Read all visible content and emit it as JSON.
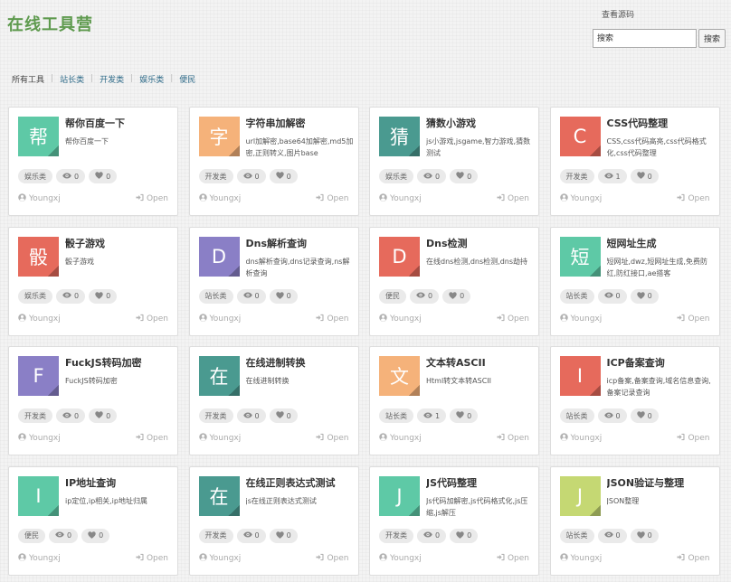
{
  "header": {
    "logo": "在线工具营",
    "source_link": "查看源码",
    "search_placeholder": "搜索",
    "search_button": "搜索"
  },
  "breadcrumb": [
    {
      "label": "所有工具",
      "link": false
    },
    {
      "label": "站长类",
      "link": true
    },
    {
      "label": "开发类",
      "link": true
    },
    {
      "label": "娱乐类",
      "link": true
    },
    {
      "label": "便民",
      "link": true
    }
  ],
  "colors": {
    "logo": "#5e9a4e",
    "teal": "#5ec9a6",
    "orange": "#f5b27a",
    "darkteal": "#4a9a90",
    "red": "#e66a5c",
    "purple": "#8a7fc6",
    "lime": "#c5d873"
  },
  "open_label": "Open",
  "tools": [
    {
      "char": "帮",
      "color": "teal",
      "title": "帮你百度一下",
      "desc": "帮你百度一下",
      "category": "娱乐类",
      "views": "0",
      "likes": "0",
      "author": "Youngxj"
    },
    {
      "char": "字",
      "color": "orange",
      "title": "字符串加解密",
      "desc": "url加解密,base64加解密,md5加密,正则转义,图片base",
      "category": "开发类",
      "views": "0",
      "likes": "0",
      "author": "Youngxj"
    },
    {
      "char": "猜",
      "color": "darkteal",
      "title": "猜数小游戏",
      "desc": "js小游戏,jsgame,智力游戏,猜数测试",
      "category": "娱乐类",
      "views": "0",
      "likes": "0",
      "author": "Youngxj"
    },
    {
      "char": "C",
      "color": "red",
      "title": "CSS代码整理",
      "desc": "CSS,css代码高亮,css代码格式化,css代码整理",
      "category": "开发类",
      "views": "1",
      "likes": "0",
      "author": "Youngxj"
    },
    {
      "char": "骰",
      "color": "red",
      "title": "骰子游戏",
      "desc": "骰子游戏",
      "category": "娱乐类",
      "views": "0",
      "likes": "0",
      "author": "Youngxj"
    },
    {
      "char": "D",
      "color": "purple",
      "title": "Dns解析查询",
      "desc": "dns解析查询,dns记录查询,ns解析查询",
      "category": "站长类",
      "views": "0",
      "likes": "0",
      "author": "Youngxj"
    },
    {
      "char": "D",
      "color": "red",
      "title": "Dns检测",
      "desc": "在线dns检测,dns检测,dns劫持",
      "category": "便民",
      "views": "0",
      "likes": "0",
      "author": "Youngxj"
    },
    {
      "char": "短",
      "color": "teal",
      "title": "短网址生成",
      "desc": "短网址,dwz,短网址生成,免费防红,防红接口,ae搭客",
      "category": "站长类",
      "views": "0",
      "likes": "0",
      "author": "Youngxj"
    },
    {
      "char": "F",
      "color": "purple",
      "title": "FuckJS转码加密",
      "desc": "FuckJS转码加密",
      "category": "开发类",
      "views": "0",
      "likes": "0",
      "author": "Youngxj"
    },
    {
      "char": "在",
      "color": "darkteal",
      "title": "在线进制转换",
      "desc": "在线进制转换",
      "category": "开发类",
      "views": "0",
      "likes": "0",
      "author": "Youngxj"
    },
    {
      "char": "文",
      "color": "orange",
      "title": "文本转ASCII",
      "desc": "Html转文本转ASCII",
      "category": "站长类",
      "views": "1",
      "likes": "0",
      "author": "Youngxj"
    },
    {
      "char": "I",
      "color": "red",
      "title": "ICP备案查询",
      "desc": "icp备案,备案查询,域名信息查询,备案记录查询",
      "category": "站长类",
      "views": "0",
      "likes": "0",
      "author": "Youngxj"
    },
    {
      "char": "I",
      "color": "teal",
      "title": "IP地址查询",
      "desc": "ip定位,ip相关,ip地址归属",
      "category": "便民",
      "views": "0",
      "likes": "0",
      "author": "Youngxj"
    },
    {
      "char": "在",
      "color": "darkteal",
      "title": "在线正则表达式测试",
      "desc": "js在线正则表达式测试",
      "category": "开发类",
      "views": "0",
      "likes": "0",
      "author": "Youngxj"
    },
    {
      "char": "J",
      "color": "teal",
      "title": "JS代码整理",
      "desc": "Js代码加解密,js代码格式化,js压缩,js解压",
      "category": "开发类",
      "views": "0",
      "likes": "0",
      "author": "Youngxj"
    },
    {
      "char": "J",
      "color": "lime",
      "title": "JSON验证与整理",
      "desc": "JSON整理",
      "category": "站长类",
      "views": "0",
      "likes": "0",
      "author": "Youngxj"
    }
  ]
}
